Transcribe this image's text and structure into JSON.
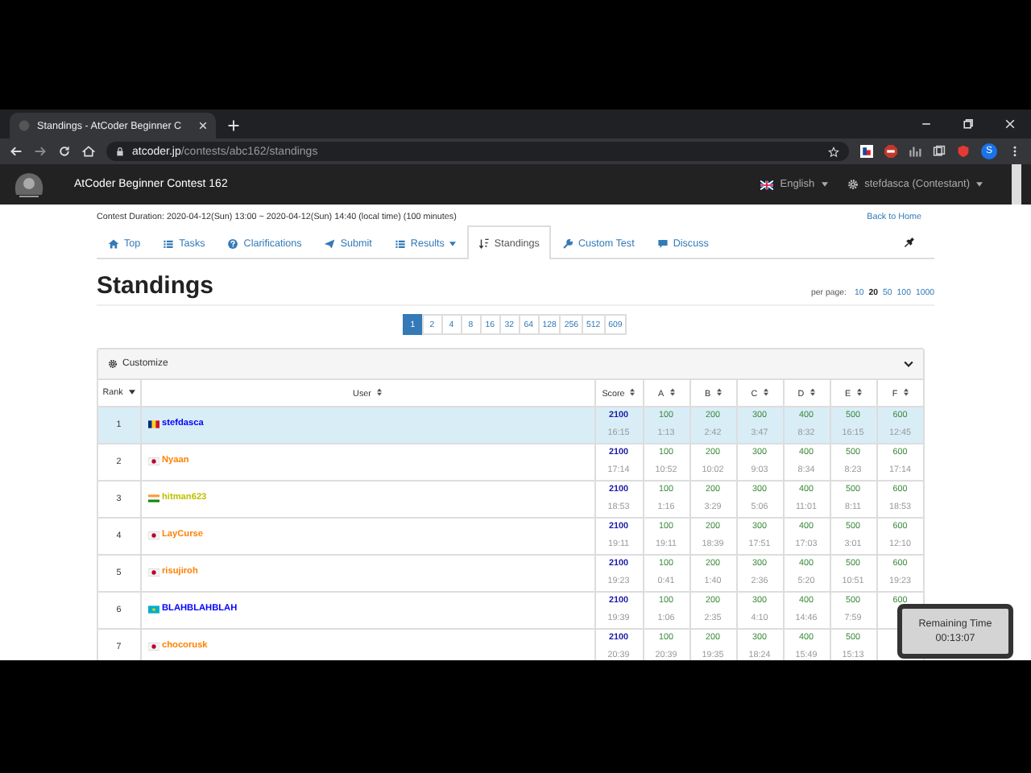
{
  "browser": {
    "tab_title": "Standings - AtCoder Beginner C",
    "url_host": "atcoder.jp",
    "url_path": "/contests/abc162/standings",
    "profile_initial": "S"
  },
  "navbar": {
    "title": "AtCoder Beginner Contest 162",
    "language": "English",
    "user": "stefdasca (Contestant)"
  },
  "contest_duration": "Contest Duration: 2020-04-12(Sun) 13:00 ~ 2020-04-12(Sun) 14:40 (local time) (100 minutes)",
  "back_link": "Back to Home",
  "tabs": [
    {
      "label": "Top",
      "kind": "home",
      "selected": false,
      "dropdown": false
    },
    {
      "label": "Tasks",
      "kind": "tasks",
      "selected": false,
      "dropdown": false
    },
    {
      "label": "Clarifications",
      "kind": "question",
      "selected": false,
      "dropdown": false
    },
    {
      "label": "Submit",
      "kind": "send",
      "selected": false,
      "dropdown": false
    },
    {
      "label": "Results",
      "kind": "list",
      "selected": false,
      "dropdown": true
    },
    {
      "label": "Standings",
      "kind": "sort",
      "selected": true,
      "dropdown": false
    },
    {
      "label": "Custom Test",
      "kind": "wrench",
      "selected": false,
      "dropdown": false
    },
    {
      "label": "Discuss",
      "kind": "comment",
      "selected": false,
      "dropdown": false
    }
  ],
  "heading": "Standings",
  "per_page": {
    "label": "per page:",
    "options": [
      {
        "label": "10",
        "selected": false
      },
      {
        "label": "20",
        "selected": true
      },
      {
        "label": "50",
        "selected": false
      },
      {
        "label": "100",
        "selected": false
      },
      {
        "label": "1000",
        "selected": false
      }
    ]
  },
  "pagination": [
    {
      "label": "1",
      "selected": true
    },
    {
      "label": "2",
      "selected": false
    },
    {
      "label": "4",
      "selected": false
    },
    {
      "label": "8",
      "selected": false
    },
    {
      "label": "16",
      "selected": false
    },
    {
      "label": "32",
      "selected": false
    },
    {
      "label": "64",
      "selected": false
    },
    {
      "label": "128",
      "selected": false
    },
    {
      "label": "256",
      "selected": false
    },
    {
      "label": "512",
      "selected": false
    },
    {
      "label": "609",
      "selected": false
    }
  ],
  "customize": "Customize",
  "table": {
    "columns": [
      {
        "label": "Rank",
        "kind": "caret"
      },
      {
        "label": "User",
        "kind": "updown"
      },
      {
        "label": "Score",
        "kind": "updown"
      },
      {
        "label": "A",
        "kind": "updown"
      },
      {
        "label": "B",
        "kind": "updown"
      },
      {
        "label": "C",
        "kind": "updown"
      },
      {
        "label": "D",
        "kind": "updown"
      },
      {
        "label": "E",
        "kind": "updown"
      },
      {
        "label": "F",
        "kind": "updown"
      }
    ],
    "rows": [
      {
        "rank": "1",
        "kind": "ro",
        "user": "stefdasca",
        "color": "#0000ff",
        "selected": true,
        "score": "2100",
        "time": "16:15",
        "tasks": [
          {
            "score": "100",
            "time": "1:13"
          },
          {
            "score": "200",
            "time": "2:42"
          },
          {
            "score": "300",
            "time": "3:47"
          },
          {
            "score": "400",
            "time": "8:32"
          },
          {
            "score": "500",
            "time": "16:15"
          },
          {
            "score": "600",
            "time": "12:45"
          }
        ]
      },
      {
        "rank": "2",
        "kind": "jp",
        "user": "Nyaan",
        "color": "#ff8000",
        "selected": false,
        "score": "2100",
        "time": "17:14",
        "tasks": [
          {
            "score": "100",
            "time": "10:52"
          },
          {
            "score": "200",
            "time": "10:02"
          },
          {
            "score": "300",
            "time": "9:03"
          },
          {
            "score": "400",
            "time": "8:34"
          },
          {
            "score": "500",
            "time": "8:23"
          },
          {
            "score": "600",
            "time": "17:14"
          }
        ]
      },
      {
        "rank": "3",
        "kind": "in",
        "user": "hitman623",
        "color": "#c0c000",
        "selected": false,
        "score": "2100",
        "time": "18:53",
        "tasks": [
          {
            "score": "100",
            "time": "1:16"
          },
          {
            "score": "200",
            "time": "3:29"
          },
          {
            "score": "300",
            "time": "5:06"
          },
          {
            "score": "400",
            "time": "11:01"
          },
          {
            "score": "500",
            "time": "8:11"
          },
          {
            "score": "600",
            "time": "18:53"
          }
        ]
      },
      {
        "rank": "4",
        "kind": "jp",
        "user": "LayCurse",
        "color": "#ff8000",
        "selected": false,
        "score": "2100",
        "time": "19:11",
        "tasks": [
          {
            "score": "100",
            "time": "19:11"
          },
          {
            "score": "200",
            "time": "18:39"
          },
          {
            "score": "300",
            "time": "17:51"
          },
          {
            "score": "400",
            "time": "17:03"
          },
          {
            "score": "500",
            "time": "3:01"
          },
          {
            "score": "600",
            "time": "12:10"
          }
        ]
      },
      {
        "rank": "5",
        "kind": "jp",
        "user": "risujiroh",
        "color": "#ff8000",
        "selected": false,
        "score": "2100",
        "time": "19:23",
        "tasks": [
          {
            "score": "100",
            "time": "0:41"
          },
          {
            "score": "200",
            "time": "1:40"
          },
          {
            "score": "300",
            "time": "2:36"
          },
          {
            "score": "400",
            "time": "5:20"
          },
          {
            "score": "500",
            "time": "10:51"
          },
          {
            "score": "600",
            "time": "19:23"
          }
        ]
      },
      {
        "rank": "6",
        "kind": "kz",
        "user": "BLAHBLAHBLAH",
        "color": "#0000ff",
        "selected": false,
        "score": "2100",
        "time": "19:39",
        "tasks": [
          {
            "score": "100",
            "time": "1:06"
          },
          {
            "score": "200",
            "time": "2:35"
          },
          {
            "score": "300",
            "time": "4:10"
          },
          {
            "score": "400",
            "time": "14:46"
          },
          {
            "score": "500",
            "time": "7:59"
          },
          {
            "score": "600"
          }
        ]
      },
      {
        "rank": "7",
        "kind": "jp",
        "user": "chocorusk",
        "color": "#ff8000",
        "selected": false,
        "score": "2100",
        "time": "20:39",
        "tasks": [
          {
            "score": "100",
            "time": "20:39"
          },
          {
            "score": "200",
            "time": "19:35"
          },
          {
            "score": "300",
            "time": "18:24"
          },
          {
            "score": "400",
            "time": "15:49"
          },
          {
            "score": "500",
            "time": "15:13"
          }
        ]
      }
    ]
  },
  "remaining": {
    "label": "Remaining Time",
    "time": "00:13:07"
  }
}
